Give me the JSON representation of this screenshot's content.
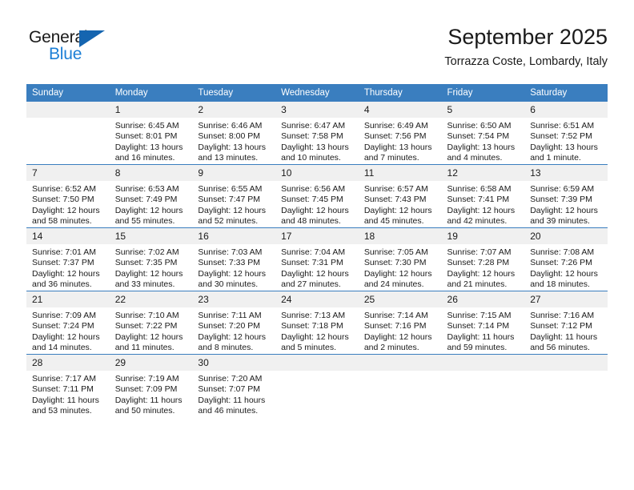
{
  "brand": {
    "name_top": "General",
    "name_bottom": "Blue",
    "accent_color": "#1565b0",
    "text_color": "#1c7fd6"
  },
  "header": {
    "title": "September 2025",
    "subtitle": "Torrazza Coste, Lombardy, Italy"
  },
  "theme": {
    "header_bg": "#3a7ebf",
    "header_text": "#ffffff",
    "daynum_bg": "#f0f0f0",
    "cell_bg": "#ffffff",
    "text": "#1a1a1a"
  },
  "weekdays": [
    "Sunday",
    "Monday",
    "Tuesday",
    "Wednesday",
    "Thursday",
    "Friday",
    "Saturday"
  ],
  "weeks": [
    [
      {
        "day": "",
        "lines": []
      },
      {
        "day": "1",
        "lines": [
          "Sunrise: 6:45 AM",
          "Sunset: 8:01 PM",
          "Daylight: 13 hours",
          "and 16 minutes."
        ]
      },
      {
        "day": "2",
        "lines": [
          "Sunrise: 6:46 AM",
          "Sunset: 8:00 PM",
          "Daylight: 13 hours",
          "and 13 minutes."
        ]
      },
      {
        "day": "3",
        "lines": [
          "Sunrise: 6:47 AM",
          "Sunset: 7:58 PM",
          "Daylight: 13 hours",
          "and 10 minutes."
        ]
      },
      {
        "day": "4",
        "lines": [
          "Sunrise: 6:49 AM",
          "Sunset: 7:56 PM",
          "Daylight: 13 hours",
          "and 7 minutes."
        ]
      },
      {
        "day": "5",
        "lines": [
          "Sunrise: 6:50 AM",
          "Sunset: 7:54 PM",
          "Daylight: 13 hours",
          "and 4 minutes."
        ]
      },
      {
        "day": "6",
        "lines": [
          "Sunrise: 6:51 AM",
          "Sunset: 7:52 PM",
          "Daylight: 13 hours",
          "and 1 minute."
        ]
      }
    ],
    [
      {
        "day": "7",
        "lines": [
          "Sunrise: 6:52 AM",
          "Sunset: 7:50 PM",
          "Daylight: 12 hours",
          "and 58 minutes."
        ]
      },
      {
        "day": "8",
        "lines": [
          "Sunrise: 6:53 AM",
          "Sunset: 7:49 PM",
          "Daylight: 12 hours",
          "and 55 minutes."
        ]
      },
      {
        "day": "9",
        "lines": [
          "Sunrise: 6:55 AM",
          "Sunset: 7:47 PM",
          "Daylight: 12 hours",
          "and 52 minutes."
        ]
      },
      {
        "day": "10",
        "lines": [
          "Sunrise: 6:56 AM",
          "Sunset: 7:45 PM",
          "Daylight: 12 hours",
          "and 48 minutes."
        ]
      },
      {
        "day": "11",
        "lines": [
          "Sunrise: 6:57 AM",
          "Sunset: 7:43 PM",
          "Daylight: 12 hours",
          "and 45 minutes."
        ]
      },
      {
        "day": "12",
        "lines": [
          "Sunrise: 6:58 AM",
          "Sunset: 7:41 PM",
          "Daylight: 12 hours",
          "and 42 minutes."
        ]
      },
      {
        "day": "13",
        "lines": [
          "Sunrise: 6:59 AM",
          "Sunset: 7:39 PM",
          "Daylight: 12 hours",
          "and 39 minutes."
        ]
      }
    ],
    [
      {
        "day": "14",
        "lines": [
          "Sunrise: 7:01 AM",
          "Sunset: 7:37 PM",
          "Daylight: 12 hours",
          "and 36 minutes."
        ]
      },
      {
        "day": "15",
        "lines": [
          "Sunrise: 7:02 AM",
          "Sunset: 7:35 PM",
          "Daylight: 12 hours",
          "and 33 minutes."
        ]
      },
      {
        "day": "16",
        "lines": [
          "Sunrise: 7:03 AM",
          "Sunset: 7:33 PM",
          "Daylight: 12 hours",
          "and 30 minutes."
        ]
      },
      {
        "day": "17",
        "lines": [
          "Sunrise: 7:04 AM",
          "Sunset: 7:31 PM",
          "Daylight: 12 hours",
          "and 27 minutes."
        ]
      },
      {
        "day": "18",
        "lines": [
          "Sunrise: 7:05 AM",
          "Sunset: 7:30 PM",
          "Daylight: 12 hours",
          "and 24 minutes."
        ]
      },
      {
        "day": "19",
        "lines": [
          "Sunrise: 7:07 AM",
          "Sunset: 7:28 PM",
          "Daylight: 12 hours",
          "and 21 minutes."
        ]
      },
      {
        "day": "20",
        "lines": [
          "Sunrise: 7:08 AM",
          "Sunset: 7:26 PM",
          "Daylight: 12 hours",
          "and 18 minutes."
        ]
      }
    ],
    [
      {
        "day": "21",
        "lines": [
          "Sunrise: 7:09 AM",
          "Sunset: 7:24 PM",
          "Daylight: 12 hours",
          "and 14 minutes."
        ]
      },
      {
        "day": "22",
        "lines": [
          "Sunrise: 7:10 AM",
          "Sunset: 7:22 PM",
          "Daylight: 12 hours",
          "and 11 minutes."
        ]
      },
      {
        "day": "23",
        "lines": [
          "Sunrise: 7:11 AM",
          "Sunset: 7:20 PM",
          "Daylight: 12 hours",
          "and 8 minutes."
        ]
      },
      {
        "day": "24",
        "lines": [
          "Sunrise: 7:13 AM",
          "Sunset: 7:18 PM",
          "Daylight: 12 hours",
          "and 5 minutes."
        ]
      },
      {
        "day": "25",
        "lines": [
          "Sunrise: 7:14 AM",
          "Sunset: 7:16 PM",
          "Daylight: 12 hours",
          "and 2 minutes."
        ]
      },
      {
        "day": "26",
        "lines": [
          "Sunrise: 7:15 AM",
          "Sunset: 7:14 PM",
          "Daylight: 11 hours",
          "and 59 minutes."
        ]
      },
      {
        "day": "27",
        "lines": [
          "Sunrise: 7:16 AM",
          "Sunset: 7:12 PM",
          "Daylight: 11 hours",
          "and 56 minutes."
        ]
      }
    ],
    [
      {
        "day": "28",
        "lines": [
          "Sunrise: 7:17 AM",
          "Sunset: 7:11 PM",
          "Daylight: 11 hours",
          "and 53 minutes."
        ]
      },
      {
        "day": "29",
        "lines": [
          "Sunrise: 7:19 AM",
          "Sunset: 7:09 PM",
          "Daylight: 11 hours",
          "and 50 minutes."
        ]
      },
      {
        "day": "30",
        "lines": [
          "Sunrise: 7:20 AM",
          "Sunset: 7:07 PM",
          "Daylight: 11 hours",
          "and 46 minutes."
        ]
      },
      {
        "day": "",
        "lines": []
      },
      {
        "day": "",
        "lines": []
      },
      {
        "day": "",
        "lines": []
      },
      {
        "day": "",
        "lines": []
      }
    ]
  ]
}
